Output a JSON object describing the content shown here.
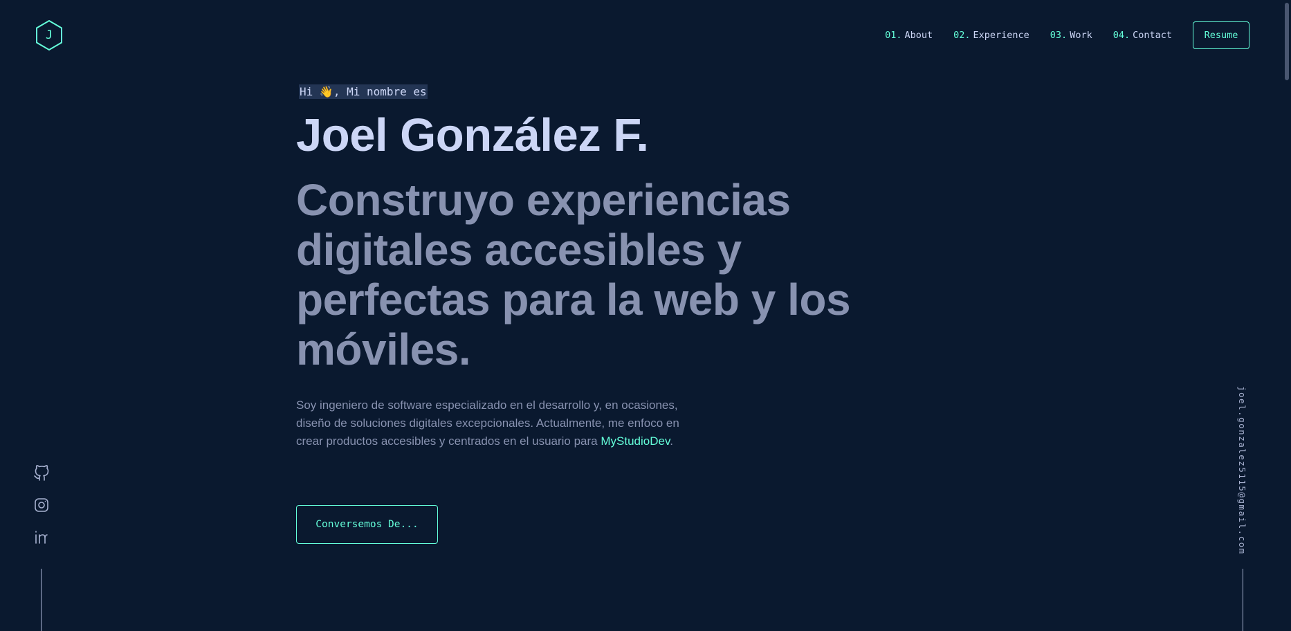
{
  "logo": {
    "letter": "J",
    "icon": "hexagon-logo-icon"
  },
  "nav": {
    "items": [
      {
        "num": "01.",
        "label": "About"
      },
      {
        "num": "02.",
        "label": "Experience"
      },
      {
        "num": "03.",
        "label": "Work"
      },
      {
        "num": "04.",
        "label": "Contact"
      }
    ],
    "resume_label": "Resume"
  },
  "hero": {
    "greeting": "Hi 👋, Mi nombre es",
    "name": "Joel González F.",
    "tagline": "Construyo experiencias digitales accesibles y perfectas para la web y los móviles.",
    "bio": "Soy ingeniero de software especializado en el desarrollo y, en ocasiones, diseño de soluciones digitales excepcionales. Actualmente, me enfoco en crear productos accesibles y centrados en el usuario para ",
    "bio_link": "MyStudioDev",
    "bio_end": ".",
    "cta_label": "Conversemos De..."
  },
  "socials": [
    {
      "icon": "github-icon"
    },
    {
      "icon": "instagram-icon"
    },
    {
      "icon": "linkedin-icon"
    }
  ],
  "email": "joel.gonzalez5115@gmail.com",
  "colors": {
    "background": "#0a192f",
    "accent": "#64ffda",
    "heading": "#ccd6f6",
    "text": "#8892b0",
    "highlight": "#233554"
  }
}
